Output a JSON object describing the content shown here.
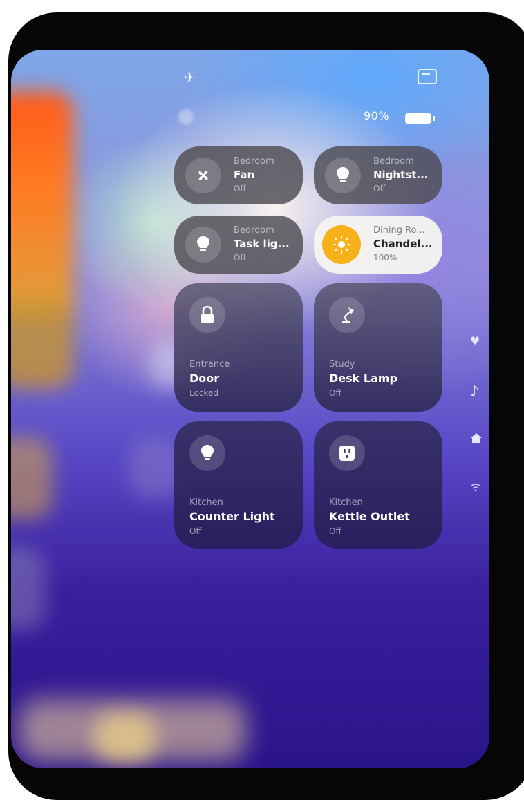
{
  "status": {
    "battery_text": "90%"
  },
  "tiles": [
    {
      "room": "Bedroom",
      "name": "Fan",
      "state": "Off",
      "icon": "fan-icon"
    },
    {
      "room": "Bedroom",
      "name": "Nightst...",
      "state": "Off",
      "icon": "lightbulb-icon"
    },
    {
      "room": "Bedroom",
      "name": "Task lig...",
      "state": "Off",
      "icon": "lightbulb-icon"
    },
    {
      "room": "Dining Ro...",
      "name": "Chandel...",
      "state": "100%",
      "icon": "sun-icon"
    },
    {
      "room": "Entrance",
      "name": "Door",
      "state": "Locked",
      "icon": "lock-icon"
    },
    {
      "room": "Study",
      "name": "Desk Lamp",
      "state": "Off",
      "icon": "desk-lamp-icon"
    },
    {
      "room": "Kitchen",
      "name": "Counter Light",
      "state": "Off",
      "icon": "lightbulb-icon"
    },
    {
      "room": "Kitchen",
      "name": "Kettle Outlet",
      "state": "Off",
      "icon": "outlet-icon"
    }
  ],
  "side_icons": [
    "heart-icon",
    "music-note-icon",
    "home-icon",
    "wifi-icon"
  ],
  "colors": {
    "accent_on": "#f6b11b",
    "tile_dark": "#4e4c52",
    "tile_on": "#f6f4f0"
  }
}
